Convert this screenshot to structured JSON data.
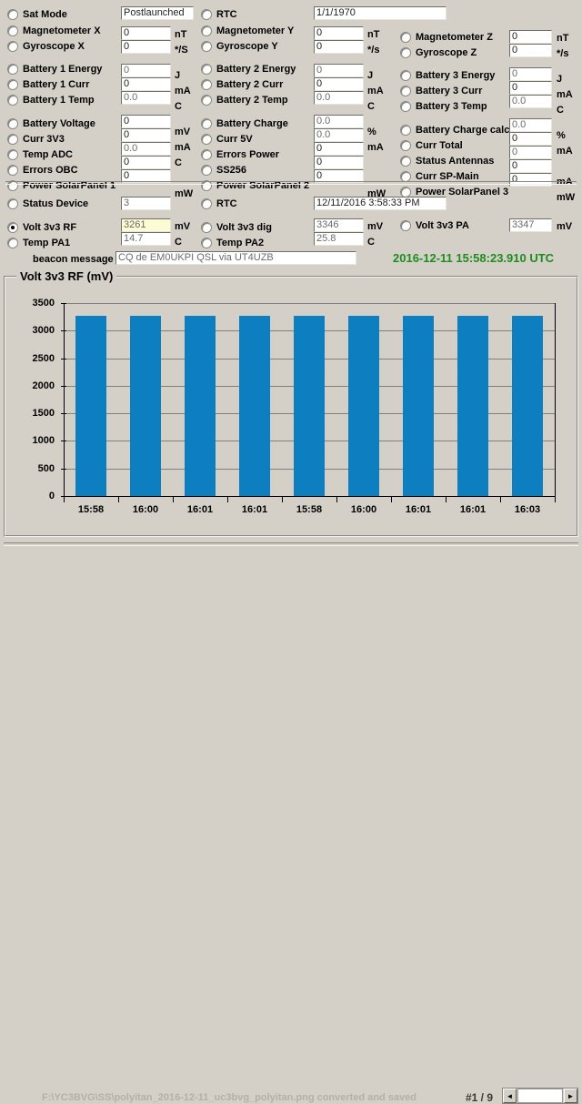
{
  "telemetry": {
    "col1": [
      {
        "label": "Sat Mode",
        "value": "Postlaunched",
        "unit": "",
        "selected": false,
        "wide": true
      },
      {
        "label": "Magnetometer X",
        "value": "0",
        "unit": "nT",
        "selected": false
      },
      {
        "label": "Gyroscope X",
        "value": "0",
        "unit": "*/S",
        "selected": false
      },
      {
        "label": "Battery 1 Energy",
        "value": "0",
        "unit": "J",
        "selected": false,
        "dim": true
      },
      {
        "label": "Battery 1 Curr",
        "value": "0",
        "unit": "mA",
        "selected": false
      },
      {
        "label": "Battery 1 Temp",
        "value": "0.0",
        "unit": "C",
        "selected": false,
        "dim": true
      },
      {
        "label": "Battery Voltage",
        "value": "0",
        "unit": "mV",
        "selected": false
      },
      {
        "label": "Curr 3V3",
        "value": "0",
        "unit": "mA",
        "selected": false
      },
      {
        "label": "Temp ADC",
        "value": "0.0",
        "unit": "C",
        "selected": false,
        "dim": true
      },
      {
        "label": "Errors OBC",
        "value": "0",
        "unit": "",
        "selected": false
      },
      {
        "label": "Power SolarPanel 1",
        "value": "0",
        "unit": "mW",
        "selected": false
      }
    ],
    "col2": [
      {
        "label": "RTC",
        "value": "1/1/1970",
        "unit": "",
        "selected": false,
        "wide": true
      },
      {
        "label": "Magnetometer Y",
        "value": "0",
        "unit": "nT",
        "selected": false
      },
      {
        "label": "Gyroscope Y",
        "value": "0",
        "unit": "*/s",
        "selected": false
      },
      {
        "label": "Battery 2 Energy",
        "value": "0",
        "unit": "J",
        "selected": false,
        "dim": true
      },
      {
        "label": "Battery 2 Curr",
        "value": "0",
        "unit": "mA",
        "selected": false
      },
      {
        "label": "Battery 2 Temp",
        "value": "0.0",
        "unit": "C",
        "selected": false,
        "dim": true
      },
      {
        "label": "Battery Charge",
        "value": "0.0",
        "unit": "%",
        "selected": false,
        "dim": true
      },
      {
        "label": "Curr 5V",
        "value": "0.0",
        "unit": "mA",
        "selected": false,
        "dim": true
      },
      {
        "label": "Errors Power",
        "value": "0",
        "unit": "",
        "selected": false
      },
      {
        "label": "SS256",
        "value": "0",
        "unit": "",
        "selected": false
      },
      {
        "label": "Power SolarPanel 2",
        "value": "0",
        "unit": "mW",
        "selected": false
      }
    ],
    "col3": [
      {
        "label": "Magnetometer Z",
        "value": "0",
        "unit": "nT",
        "selected": false
      },
      {
        "label": "Gyroscope Z",
        "value": "0",
        "unit": "*/s",
        "selected": false
      },
      {
        "label": "Battery 3 Energy",
        "value": "0",
        "unit": "J",
        "selected": false,
        "dim": true
      },
      {
        "label": "Battery 3 Curr",
        "value": "0",
        "unit": "mA",
        "selected": false
      },
      {
        "label": "Battery 3 Temp",
        "value": "0.0",
        "unit": "C",
        "selected": false,
        "dim": true
      },
      {
        "label": "Battery Charge calc.",
        "value": "0.0",
        "unit": "%",
        "selected": false,
        "dim": true
      },
      {
        "label": "Curr Total",
        "value": "0",
        "unit": "mA",
        "selected": false
      },
      {
        "label": "Status Antennas",
        "value": "0",
        "unit": "",
        "selected": false,
        "dim": true
      },
      {
        "label": "Curr SP-Main",
        "value": "0",
        "unit": "mA",
        "selected": false
      },
      {
        "label": "Power SolarPanel 3",
        "value": "0",
        "unit": "mW",
        "selected": false
      }
    ]
  },
  "mid": {
    "status_device": {
      "label": "Status Device",
      "value": "3",
      "selected": false
    },
    "rtc": {
      "label": "RTC",
      "value": "12/11/2016 3:58:33 PM",
      "selected": false
    },
    "volt_3v3_rf": {
      "label": "Volt 3v3 RF",
      "value": "3261",
      "unit": "mV",
      "selected": true
    },
    "temp_pa1": {
      "label": "Temp PA1",
      "value": "14.7",
      "unit": "C",
      "selected": false
    },
    "volt_3v3_dig": {
      "label": "Volt 3v3 dig",
      "value": "3346",
      "unit": "mV",
      "selected": false
    },
    "temp_pa2": {
      "label": "Temp PA2",
      "value": "25.8",
      "unit": "C",
      "selected": false
    },
    "volt_3v3_pa": {
      "label": "Volt 3v3 PA",
      "value": "3347",
      "unit": "mV",
      "selected": false
    },
    "beacon_label": "beacon message",
    "beacon_value": "CQ de EM0UKPI QSL via UT4UZB",
    "utc_time": "2016-12-11 15:58:23.910 UTC",
    "utc_color": "#1f8c1f"
  },
  "chart_data": {
    "type": "bar",
    "title": "Volt 3v3 RF (mV)",
    "xlabel": "",
    "ylabel": "",
    "ylim": [
      0,
      3500
    ],
    "yticks": [
      0,
      500,
      1000,
      1500,
      2000,
      2500,
      3000,
      3500
    ],
    "grid": true,
    "legend": "none",
    "bar_color": "#0d7ec0",
    "categories": [
      "15:58",
      "16:00",
      "16:01",
      "16:01",
      "15:58",
      "16:00",
      "16:01",
      "16:01",
      "16:03"
    ],
    "values": [
      3261,
      3261,
      3261,
      3261,
      3261,
      3261,
      3261,
      3261,
      3261
    ]
  },
  "statusbar": {
    "message": "F:\\YC3BVG\\SS\\polyitan_2016-12-11_uc3bvg_polyitan.png converted and saved",
    "page_indicator": "#1 / 9",
    "scroll_left_icon": "◄",
    "scroll_right_icon": "►"
  }
}
